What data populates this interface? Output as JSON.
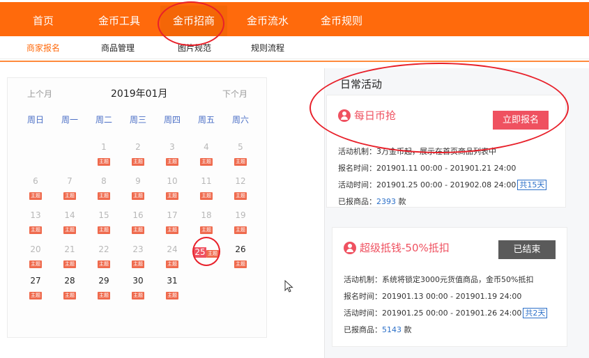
{
  "nav": {
    "items": [
      "首页",
      "金币工具",
      "金币招商",
      "金币流水",
      "金币规则"
    ]
  },
  "subnav": {
    "items": [
      "商家报名",
      "商品管理",
      "图片规范",
      "规则流程"
    ]
  },
  "calendar": {
    "prev": "上个月",
    "title": "2019年01月",
    "next": "下个月",
    "weekdays": [
      "周日",
      "周一",
      "周二",
      "周三",
      "周四",
      "周五",
      "周六"
    ],
    "tag": "主题",
    "today": "25"
  },
  "daily": {
    "title": "日常活动",
    "cards": [
      {
        "name": "每日币抢",
        "button": "立即报名",
        "mechanism": "活动机制：3万金币起，展示在首页商品列表中",
        "signup_time": "报名时间：201901.11 00:00 - 201901.21 24:00",
        "activity_time": "活动时间：201901.25 00:00 - 201902.08 24:00",
        "duration": "共15天",
        "reported_label": "已报商品：",
        "reported_count": "2393",
        "reported_unit": "款"
      },
      {
        "name": "超级抵钱-50%抵扣",
        "button": "已结束",
        "mechanism": "活动机制：系统将锁定3000元货值商品，金币50%抵扣",
        "signup_time": "报名时间：201901.13 00:00 - 201901.19 24:00",
        "activity_time": "活动时间：201901.25 00:00 - 201901.26 24:00",
        "duration": "共2天",
        "reported_label": "已报商品：",
        "reported_count": "5143",
        "reported_unit": "款"
      }
    ]
  },
  "colors": {
    "nav": "#ff6a0c",
    "accent_red": "#ef5160",
    "annotation": "#e8202a",
    "weekday_blue": "#4b6fc6"
  }
}
